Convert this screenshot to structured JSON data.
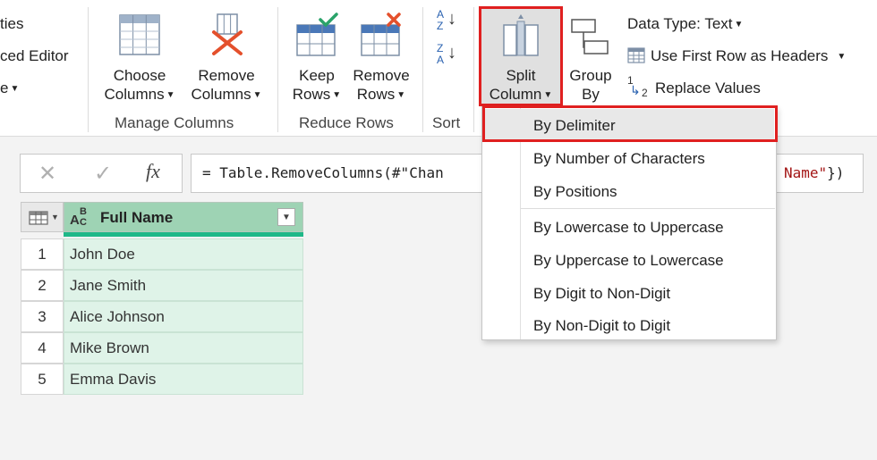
{
  "ribbon": {
    "left_items": [
      {
        "label": "ties"
      },
      {
        "label": "ced Editor"
      },
      {
        "label": "e"
      }
    ],
    "manage_columns": {
      "choose_line1": "Choose",
      "choose_line2": "Columns",
      "remove_line1": "Remove",
      "remove_line2": "Columns",
      "group_label": "Manage Columns"
    },
    "reduce_rows": {
      "keep_line1": "Keep",
      "keep_line2": "Rows",
      "remove_line1": "Remove",
      "remove_line2": "Rows",
      "group_label": "Reduce Rows"
    },
    "sort": {
      "asc_top": "A",
      "asc_bottom": "Z",
      "desc_top": "Z",
      "desc_bottom": "A",
      "group_label": "Sort"
    },
    "transform": {
      "split_line1": "Split",
      "split_line2": "Column",
      "group_line1": "Group",
      "group_line2": "By",
      "data_type": "Data Type: Text",
      "first_row_headers": "Use First Row as Headers",
      "replace_values": "Replace Values",
      "replace_num1": "1",
      "replace_num2": "2"
    }
  },
  "formula_bar": {
    "cancel_symbol": "✕",
    "confirm_symbol": "✓",
    "fx_label": "fx",
    "formula_text": "= Table.RemoveColumns(#\"Chan",
    "formula_tail_red": "Name\"",
    "formula_tail_close": "})"
  },
  "table": {
    "type_icon_top": "B",
    "type_icon_a": "A",
    "type_icon_c": "C",
    "column_header": "Full Name",
    "rows": [
      {
        "num": "1",
        "value": "John Doe"
      },
      {
        "num": "2",
        "value": "Jane Smith"
      },
      {
        "num": "3",
        "value": "Alice Johnson"
      },
      {
        "num": "4",
        "value": "Mike Brown"
      },
      {
        "num": "5",
        "value": "Emma Davis"
      }
    ]
  },
  "split_menu": {
    "items": [
      {
        "label": "By Delimiter"
      },
      {
        "label": "By Number of Characters"
      },
      {
        "label": "By Positions"
      },
      {
        "label": "By Lowercase to Uppercase"
      },
      {
        "label": "By Uppercase to Lowercase"
      },
      {
        "label": "By Digit to Non-Digit"
      },
      {
        "label": "By Non-Digit to Digit"
      }
    ]
  },
  "colors": {
    "highlight": "#e02020",
    "header_green": "#9ed3b4",
    "cell_green": "#dff3e8",
    "accent_strip": "#1fb888",
    "formula_string_red": "#a31515"
  },
  "icons": {
    "choose": "choose-columns-icon",
    "remove": "remove-columns-icon",
    "keep": "keep-rows-icon",
    "remove_rows": "remove-rows-icon",
    "split": "split-column-icon",
    "group": "group-by-icon"
  }
}
